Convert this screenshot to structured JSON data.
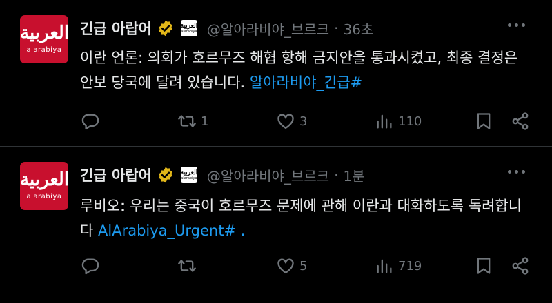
{
  "tweets": [
    {
      "avatar_logo_ar": "العربية",
      "avatar_logo_latin": "alarabiya",
      "affiliate_badge_text": "العربية",
      "affiliate_badge_sub": "alarabiya",
      "name": "긴급 아랍어",
      "handle": "@알아라비야_브르크",
      "dot": "·",
      "time": "36초",
      "text": "이란 언론: 의회가 호르무즈 해협 항해 금지안을 통과시켰고, 최종 결정은 안보 당국에 달려 있습니다.",
      "link": "알아라비야_긴급#",
      "link_suffix": "",
      "reply_count": "",
      "retweet_count": "1",
      "like_count": "3",
      "view_count": "110"
    },
    {
      "avatar_logo_ar": "العربية",
      "avatar_logo_latin": "alarabiya",
      "affiliate_badge_text": "العربية",
      "affiliate_badge_sub": "alarabiya",
      "name": "긴급 아랍어",
      "handle": "@알아라비야_브르크",
      "dot": "·",
      "time": "1분",
      "text": "루비오: 우리는 중국이 호르무즈 문제에 관해 이란과 대화하도록 독려합니다",
      "link": "AlArabiya_Urgent#",
      "link_suffix": " .",
      "reply_count": "",
      "retweet_count": "",
      "like_count": "5",
      "view_count": "719"
    }
  ],
  "colors": {
    "background": "#000000",
    "text": "#e7e9ea",
    "muted": "#71767b",
    "link": "#1d9bf0",
    "verified_badge": "#e2b719",
    "avatar_red": "#c8102e",
    "divider": "#2f3336"
  },
  "icons": [
    "verified-badge-icon",
    "more-icon",
    "reply-icon",
    "retweet-icon",
    "like-icon",
    "views-icon",
    "bookmark-icon",
    "share-icon"
  ]
}
